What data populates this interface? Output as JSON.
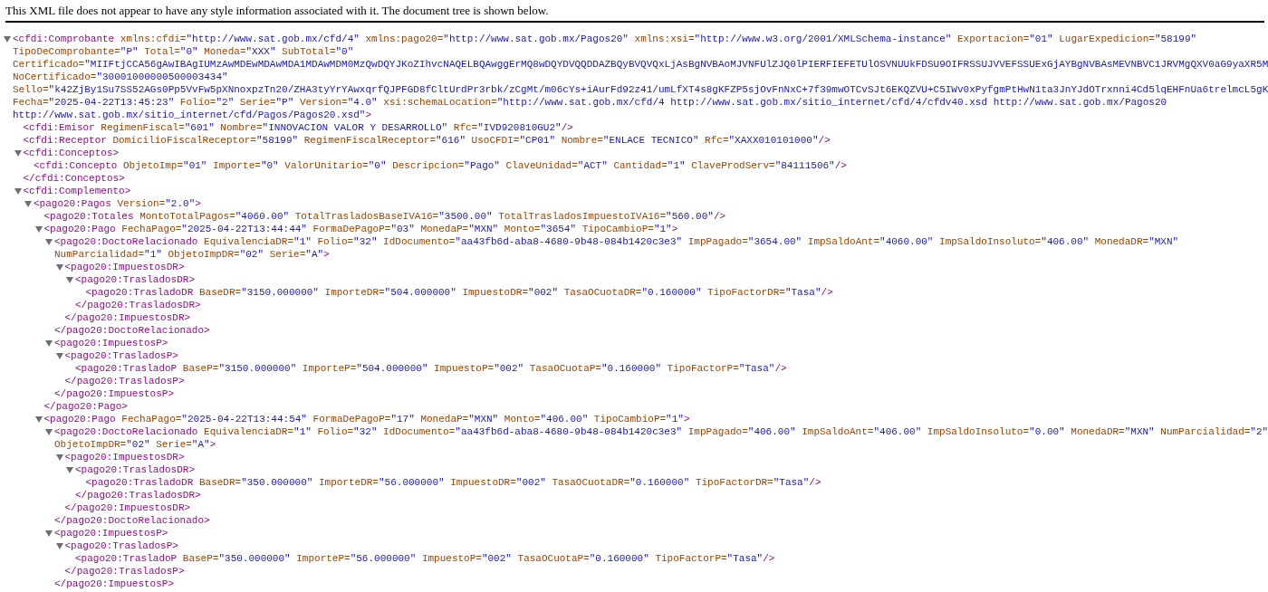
{
  "header": {
    "message": "This XML file does not appear to have any style information associated with it. The document tree is shown below."
  },
  "tree": {
    "expanded": true,
    "open": [
      [
        {
          "kind": "tag",
          "text": "<cfdi:Comprobante"
        },
        {
          "kind": "attr",
          "text": " xmlns:cfdi="
        },
        {
          "kind": "value",
          "text": "\"http://www.sat.gob.mx/cfd/4\""
        },
        {
          "kind": "attr",
          "text": " xmlns:pago20="
        },
        {
          "kind": "value",
          "text": "\"http://www.sat.gob.mx/Pagos20\""
        },
        {
          "kind": "attr",
          "text": " xmlns:xsi="
        },
        {
          "kind": "value",
          "text": "\"http://www.w3.org/2001/XMLSchema-instance\""
        },
        {
          "kind": "attr",
          "text": " Exportacion="
        },
        {
          "kind": "value",
          "text": "\"01\""
        },
        {
          "kind": "attr",
          "text": " LugarExpedicion="
        },
        {
          "kind": "value",
          "text": "\"58199\""
        }
      ],
      [
        {
          "kind": "attr",
          "text": "TipoDeComprobante="
        },
        {
          "kind": "value",
          "text": "\"P\""
        },
        {
          "kind": "attr",
          "text": " Total="
        },
        {
          "kind": "value",
          "text": "\"0\""
        },
        {
          "kind": "attr",
          "text": " Moneda="
        },
        {
          "kind": "value",
          "text": "\"XXX\""
        },
        {
          "kind": "attr",
          "text": " SubTotal="
        },
        {
          "kind": "value",
          "text": "\"0\""
        }
      ],
      [
        {
          "kind": "attr",
          "text": "Certificado="
        },
        {
          "kind": "value",
          "text": "\"MIIFtjCCA56gAwIBAgIUMzAwMDEwMDAwMDA1MDAwMDM0MzQwDQYJKoZIhvcNAQELBQAwggErMQ8wDQYDVQQDDAZBQyBVQVQxLjAsBgNVBAoMJVNFUlZJQ0lPIERFIEFETUlOSVNUUkFDSU9OIFRSSUJVVEFSSUExGjAYBgNVBAsMEVNBVC1JRVMgQXV0aG9yaXR5M"
        }
      ],
      [
        {
          "kind": "attr",
          "text": "NoCertificado="
        },
        {
          "kind": "value",
          "text": "\"30001000000500003434\""
        }
      ],
      [
        {
          "kind": "attr",
          "text": "Sello="
        },
        {
          "kind": "value",
          "text": "\"k42ZjBy1Su7SS52AGs0Pp5VvFw5pXNnoxpzTn20/ZHA3tyYrYAwxqrfQJPFGD8fCltUrdPr3rbk/zCgMt/m06cYs+iAurFd92z41/umLfXT4s8gKFZP5sjOvFnNxC+7f39mwOTCvSJt6EKQZVU+C5IWv0xPyfgmPtHwN1ta3JnYJdOTrxnni4Cd5lqEHFnUa6trelmcL5gK"
        }
      ],
      [
        {
          "kind": "attr",
          "text": "Fecha="
        },
        {
          "kind": "value",
          "text": "\"2025-04-22T13:45:23\""
        },
        {
          "kind": "attr",
          "text": " Folio="
        },
        {
          "kind": "value",
          "text": "\"2\""
        },
        {
          "kind": "attr",
          "text": " Serie="
        },
        {
          "kind": "value",
          "text": "\"P\""
        },
        {
          "kind": "attr",
          "text": " Version="
        },
        {
          "kind": "value",
          "text": "\"4.0\""
        },
        {
          "kind": "attr",
          "text": " xsi:schemaLocation="
        },
        {
          "kind": "value",
          "text": "\"http://www.sat.gob.mx/cfd/4 http://www.sat.gob.mx/sitio_internet/cfd/4/cfdv40.xsd http://www.sat.gob.mx/Pagos20"
        }
      ],
      [
        {
          "kind": "value",
          "text": "http://www.sat.gob.mx/sitio_internet/cfd/Pagos/Pagos20.xsd\""
        },
        {
          "kind": "tag",
          "text": ">"
        }
      ]
    ],
    "children": [
      {
        "open": [
          [
            {
              "kind": "tag",
              "text": "<cfdi:Emisor"
            },
            {
              "kind": "attr",
              "text": " RegimenFiscal="
            },
            {
              "kind": "value",
              "text": "\"601\""
            },
            {
              "kind": "attr",
              "text": " Nombre="
            },
            {
              "kind": "value",
              "text": "\"INNOVACION VALOR Y DESARROLLO\""
            },
            {
              "kind": "attr",
              "text": " Rfc="
            },
            {
              "kind": "value",
              "text": "\"IVD920810GU2\""
            },
            {
              "kind": "tag",
              "text": "/>"
            }
          ]
        ]
      },
      {
        "open": [
          [
            {
              "kind": "tag",
              "text": "<cfdi:Receptor"
            },
            {
              "kind": "attr",
              "text": " DomicilioFiscalReceptor="
            },
            {
              "kind": "value",
              "text": "\"58199\""
            },
            {
              "kind": "attr",
              "text": " RegimenFiscalReceptor="
            },
            {
              "kind": "value",
              "text": "\"616\""
            },
            {
              "kind": "attr",
              "text": " UsoCFDI="
            },
            {
              "kind": "value",
              "text": "\"CP01\""
            },
            {
              "kind": "attr",
              "text": " Nombre="
            },
            {
              "kind": "value",
              "text": "\"ENLACE TECNICO\""
            },
            {
              "kind": "attr",
              "text": " Rfc="
            },
            {
              "kind": "value",
              "text": "\"XAXX010101000\""
            },
            {
              "kind": "tag",
              "text": "/>"
            }
          ]
        ]
      },
      {
        "expanded": true,
        "open": [
          [
            {
              "kind": "tag",
              "text": "<cfdi:Conceptos>"
            }
          ]
        ],
        "children": [
          {
            "open": [
              [
                {
                  "kind": "tag",
                  "text": "<cfdi:Concepto"
                },
                {
                  "kind": "attr",
                  "text": " ObjetoImp="
                },
                {
                  "kind": "value",
                  "text": "\"01\""
                },
                {
                  "kind": "attr",
                  "text": " Importe="
                },
                {
                  "kind": "value",
                  "text": "\"0\""
                },
                {
                  "kind": "attr",
                  "text": " ValorUnitario="
                },
                {
                  "kind": "value",
                  "text": "\"0\""
                },
                {
                  "kind": "attr",
                  "text": " Descripcion="
                },
                {
                  "kind": "value",
                  "text": "\"Pago\""
                },
                {
                  "kind": "attr",
                  "text": " ClaveUnidad="
                },
                {
                  "kind": "value",
                  "text": "\"ACT\""
                },
                {
                  "kind": "attr",
                  "text": " Cantidad="
                },
                {
                  "kind": "value",
                  "text": "\"1\""
                },
                {
                  "kind": "attr",
                  "text": " ClaveProdServ="
                },
                {
                  "kind": "value",
                  "text": "\"84111506\""
                },
                {
                  "kind": "tag",
                  "text": "/>"
                }
              ]
            ]
          }
        ],
        "close": "</cfdi:Conceptos>"
      },
      {
        "expanded": true,
        "open": [
          [
            {
              "kind": "tag",
              "text": "<cfdi:Complemento>"
            }
          ]
        ],
        "children": [
          {
            "expanded": true,
            "open": [
              [
                {
                  "kind": "tag",
                  "text": "<pago20:Pagos"
                },
                {
                  "kind": "attr",
                  "text": " Version="
                },
                {
                  "kind": "value",
                  "text": "\"2.0\""
                },
                {
                  "kind": "tag",
                  "text": ">"
                }
              ]
            ],
            "children": [
              {
                "open": [
                  [
                    {
                      "kind": "tag",
                      "text": "<pago20:Totales"
                    },
                    {
                      "kind": "attr",
                      "text": " MontoTotalPagos="
                    },
                    {
                      "kind": "value",
                      "text": "\"4060.00\""
                    },
                    {
                      "kind": "attr",
                      "text": " TotalTrasladosBaseIVA16="
                    },
                    {
                      "kind": "value",
                      "text": "\"3500.00\""
                    },
                    {
                      "kind": "attr",
                      "text": " TotalTrasladosImpuestoIVA16="
                    },
                    {
                      "kind": "value",
                      "text": "\"560.00\""
                    },
                    {
                      "kind": "tag",
                      "text": "/>"
                    }
                  ]
                ]
              },
              {
                "expanded": true,
                "open": [
                  [
                    {
                      "kind": "tag",
                      "text": "<pago20:Pago"
                    },
                    {
                      "kind": "attr",
                      "text": " FechaPago="
                    },
                    {
                      "kind": "value",
                      "text": "\"2025-04-22T13:44:44\""
                    },
                    {
                      "kind": "attr",
                      "text": " FormaDePagoP="
                    },
                    {
                      "kind": "value",
                      "text": "\"03\""
                    },
                    {
                      "kind": "attr",
                      "text": " MonedaP="
                    },
                    {
                      "kind": "value",
                      "text": "\"MXN\""
                    },
                    {
                      "kind": "attr",
                      "text": " Monto="
                    },
                    {
                      "kind": "value",
                      "text": "\"3654\""
                    },
                    {
                      "kind": "attr",
                      "text": " TipoCambioP="
                    },
                    {
                      "kind": "value",
                      "text": "\"1\""
                    },
                    {
                      "kind": "tag",
                      "text": ">"
                    }
                  ]
                ],
                "children": [
                  {
                    "expanded": true,
                    "open": [
                      [
                        {
                          "kind": "tag",
                          "text": "<pago20:DoctoRelacionado"
                        },
                        {
                          "kind": "attr",
                          "text": " EquivalenciaDR="
                        },
                        {
                          "kind": "value",
                          "text": "\"1\""
                        },
                        {
                          "kind": "attr",
                          "text": " Folio="
                        },
                        {
                          "kind": "value",
                          "text": "\"32\""
                        },
                        {
                          "kind": "attr",
                          "text": " IdDocumento="
                        },
                        {
                          "kind": "value",
                          "text": "\"aa43fb6d-aba8-4680-9b48-084b1420c3e3\""
                        },
                        {
                          "kind": "attr",
                          "text": " ImpPagado="
                        },
                        {
                          "kind": "value",
                          "text": "\"3654.00\""
                        },
                        {
                          "kind": "attr",
                          "text": " ImpSaldoAnt="
                        },
                        {
                          "kind": "value",
                          "text": "\"4060.00\""
                        },
                        {
                          "kind": "attr",
                          "text": " ImpSaldoInsoluto="
                        },
                        {
                          "kind": "value",
                          "text": "\"406.00\""
                        },
                        {
                          "kind": "attr",
                          "text": " MonedaDR="
                        },
                        {
                          "kind": "value",
                          "text": "\"MXN\""
                        }
                      ],
                      [
                        {
                          "kind": "attr",
                          "text": "NumParcialidad="
                        },
                        {
                          "kind": "value",
                          "text": "\"1\""
                        },
                        {
                          "kind": "attr",
                          "text": " ObjetoImpDR="
                        },
                        {
                          "kind": "value",
                          "text": "\"02\""
                        },
                        {
                          "kind": "attr",
                          "text": " Serie="
                        },
                        {
                          "kind": "value",
                          "text": "\"A\""
                        },
                        {
                          "kind": "tag",
                          "text": ">"
                        }
                      ]
                    ],
                    "children": [
                      {
                        "expanded": true,
                        "open": [
                          [
                            {
                              "kind": "tag",
                              "text": "<pago20:ImpuestosDR>"
                            }
                          ]
                        ],
                        "children": [
                          {
                            "expanded": true,
                            "open": [
                              [
                                {
                                  "kind": "tag",
                                  "text": "<pago20:TrasladosDR>"
                                }
                              ]
                            ],
                            "children": [
                              {
                                "open": [
                                  [
                                    {
                                      "kind": "tag",
                                      "text": "<pago20:TrasladoDR"
                                    },
                                    {
                                      "kind": "attr",
                                      "text": " BaseDR="
                                    },
                                    {
                                      "kind": "value",
                                      "text": "\"3150.000000\""
                                    },
                                    {
                                      "kind": "attr",
                                      "text": " ImporteDR="
                                    },
                                    {
                                      "kind": "value",
                                      "text": "\"504.000000\""
                                    },
                                    {
                                      "kind": "attr",
                                      "text": " ImpuestoDR="
                                    },
                                    {
                                      "kind": "value",
                                      "text": "\"002\""
                                    },
                                    {
                                      "kind": "attr",
                                      "text": " TasaOCuotaDR="
                                    },
                                    {
                                      "kind": "value",
                                      "text": "\"0.160000\""
                                    },
                                    {
                                      "kind": "attr",
                                      "text": " TipoFactorDR="
                                    },
                                    {
                                      "kind": "value",
                                      "text": "\"Tasa\""
                                    },
                                    {
                                      "kind": "tag",
                                      "text": "/>"
                                    }
                                  ]
                                ]
                              }
                            ],
                            "close": "</pago20:TrasladosDR>"
                          }
                        ],
                        "close": "</pago20:ImpuestosDR>"
                      }
                    ],
                    "close": "</pago20:DoctoRelacionado>"
                  },
                  {
                    "expanded": true,
                    "open": [
                      [
                        {
                          "kind": "tag",
                          "text": "<pago20:ImpuestosP>"
                        }
                      ]
                    ],
                    "children": [
                      {
                        "expanded": true,
                        "open": [
                          [
                            {
                              "kind": "tag",
                              "text": "<pago20:TrasladosP>"
                            }
                          ]
                        ],
                        "children": [
                          {
                            "open": [
                              [
                                {
                                  "kind": "tag",
                                  "text": "<pago20:TrasladoP"
                                },
                                {
                                  "kind": "attr",
                                  "text": " BaseP="
                                },
                                {
                                  "kind": "value",
                                  "text": "\"3150.000000\""
                                },
                                {
                                  "kind": "attr",
                                  "text": " ImporteP="
                                },
                                {
                                  "kind": "value",
                                  "text": "\"504.000000\""
                                },
                                {
                                  "kind": "attr",
                                  "text": " ImpuestoP="
                                },
                                {
                                  "kind": "value",
                                  "text": "\"002\""
                                },
                                {
                                  "kind": "attr",
                                  "text": " TasaOCuotaP="
                                },
                                {
                                  "kind": "value",
                                  "text": "\"0.160000\""
                                },
                                {
                                  "kind": "attr",
                                  "text": " TipoFactorP="
                                },
                                {
                                  "kind": "value",
                                  "text": "\"Tasa\""
                                },
                                {
                                  "kind": "tag",
                                  "text": "/>"
                                }
                              ]
                            ]
                          }
                        ],
                        "close": "</pago20:TrasladosP>"
                      }
                    ],
                    "close": "</pago20:ImpuestosP>"
                  }
                ],
                "close": "</pago20:Pago>"
              },
              {
                "expanded": true,
                "open": [
                  [
                    {
                      "kind": "tag",
                      "text": "<pago20:Pago"
                    },
                    {
                      "kind": "attr",
                      "text": " FechaPago="
                    },
                    {
                      "kind": "value",
                      "text": "\"2025-04-22T13:44:54\""
                    },
                    {
                      "kind": "attr",
                      "text": " FormaDePagoP="
                    },
                    {
                      "kind": "value",
                      "text": "\"17\""
                    },
                    {
                      "kind": "attr",
                      "text": " MonedaP="
                    },
                    {
                      "kind": "value",
                      "text": "\"MXN\""
                    },
                    {
                      "kind": "attr",
                      "text": " Monto="
                    },
                    {
                      "kind": "value",
                      "text": "\"406.00\""
                    },
                    {
                      "kind": "attr",
                      "text": " TipoCambioP="
                    },
                    {
                      "kind": "value",
                      "text": "\"1\""
                    },
                    {
                      "kind": "tag",
                      "text": ">"
                    }
                  ]
                ],
                "children": [
                  {
                    "expanded": true,
                    "open": [
                      [
                        {
                          "kind": "tag",
                          "text": "<pago20:DoctoRelacionado"
                        },
                        {
                          "kind": "attr",
                          "text": " EquivalenciaDR="
                        },
                        {
                          "kind": "value",
                          "text": "\"1\""
                        },
                        {
                          "kind": "attr",
                          "text": " Folio="
                        },
                        {
                          "kind": "value",
                          "text": "\"32\""
                        },
                        {
                          "kind": "attr",
                          "text": " IdDocumento="
                        },
                        {
                          "kind": "value",
                          "text": "\"aa43fb6d-aba8-4680-9b48-084b1420c3e3\""
                        },
                        {
                          "kind": "attr",
                          "text": " ImpPagado="
                        },
                        {
                          "kind": "value",
                          "text": "\"406.00\""
                        },
                        {
                          "kind": "attr",
                          "text": " ImpSaldoAnt="
                        },
                        {
                          "kind": "value",
                          "text": "\"406.00\""
                        },
                        {
                          "kind": "attr",
                          "text": " ImpSaldoInsoluto="
                        },
                        {
                          "kind": "value",
                          "text": "\"0.00\""
                        },
                        {
                          "kind": "attr",
                          "text": " MonedaDR="
                        },
                        {
                          "kind": "value",
                          "text": "\"MXN\""
                        },
                        {
                          "kind": "attr",
                          "text": " NumParcialidad="
                        },
                        {
                          "kind": "value",
                          "text": "\"2\""
                        }
                      ],
                      [
                        {
                          "kind": "attr",
                          "text": "ObjetoImpDR="
                        },
                        {
                          "kind": "value",
                          "text": "\"02\""
                        },
                        {
                          "kind": "attr",
                          "text": " Serie="
                        },
                        {
                          "kind": "value",
                          "text": "\"A\""
                        },
                        {
                          "kind": "tag",
                          "text": ">"
                        }
                      ]
                    ],
                    "children": [
                      {
                        "expanded": true,
                        "open": [
                          [
                            {
                              "kind": "tag",
                              "text": "<pago20:ImpuestosDR>"
                            }
                          ]
                        ],
                        "children": [
                          {
                            "expanded": true,
                            "open": [
                              [
                                {
                                  "kind": "tag",
                                  "text": "<pago20:TrasladosDR>"
                                }
                              ]
                            ],
                            "children": [
                              {
                                "open": [
                                  [
                                    {
                                      "kind": "tag",
                                      "text": "<pago20:TrasladoDR"
                                    },
                                    {
                                      "kind": "attr",
                                      "text": " BaseDR="
                                    },
                                    {
                                      "kind": "value",
                                      "text": "\"350.000000\""
                                    },
                                    {
                                      "kind": "attr",
                                      "text": " ImporteDR="
                                    },
                                    {
                                      "kind": "value",
                                      "text": "\"56.000000\""
                                    },
                                    {
                                      "kind": "attr",
                                      "text": " ImpuestoDR="
                                    },
                                    {
                                      "kind": "value",
                                      "text": "\"002\""
                                    },
                                    {
                                      "kind": "attr",
                                      "text": " TasaOCuotaDR="
                                    },
                                    {
                                      "kind": "value",
                                      "text": "\"0.160000\""
                                    },
                                    {
                                      "kind": "attr",
                                      "text": " TipoFactorDR="
                                    },
                                    {
                                      "kind": "value",
                                      "text": "\"Tasa\""
                                    },
                                    {
                                      "kind": "tag",
                                      "text": "/>"
                                    }
                                  ]
                                ]
                              }
                            ],
                            "close": "</pago20:TrasladosDR>"
                          }
                        ],
                        "close": "</pago20:ImpuestosDR>"
                      }
                    ],
                    "close": "</pago20:DoctoRelacionado>"
                  },
                  {
                    "expanded": true,
                    "open": [
                      [
                        {
                          "kind": "tag",
                          "text": "<pago20:ImpuestosP>"
                        }
                      ]
                    ],
                    "children": [
                      {
                        "expanded": true,
                        "open": [
                          [
                            {
                              "kind": "tag",
                              "text": "<pago20:TrasladosP>"
                            }
                          ]
                        ],
                        "children": [
                          {
                            "open": [
                              [
                                {
                                  "kind": "tag",
                                  "text": "<pago20:TrasladoP"
                                },
                                {
                                  "kind": "attr",
                                  "text": " BaseP="
                                },
                                {
                                  "kind": "value",
                                  "text": "\"350.000000\""
                                },
                                {
                                  "kind": "attr",
                                  "text": " ImporteP="
                                },
                                {
                                  "kind": "value",
                                  "text": "\"56.000000\""
                                },
                                {
                                  "kind": "attr",
                                  "text": " ImpuestoP="
                                },
                                {
                                  "kind": "value",
                                  "text": "\"002\""
                                },
                                {
                                  "kind": "attr",
                                  "text": " TasaOCuotaP="
                                },
                                {
                                  "kind": "value",
                                  "text": "\"0.160000\""
                                },
                                {
                                  "kind": "attr",
                                  "text": " TipoFactorP="
                                },
                                {
                                  "kind": "value",
                                  "text": "\"Tasa\""
                                },
                                {
                                  "kind": "tag",
                                  "text": "/>"
                                }
                              ]
                            ]
                          }
                        ],
                        "close": "</pago20:TrasladosP>"
                      }
                    ],
                    "close": "</pago20:ImpuestosP>"
                  }
                ]
              }
            ]
          }
        ]
      }
    ]
  }
}
